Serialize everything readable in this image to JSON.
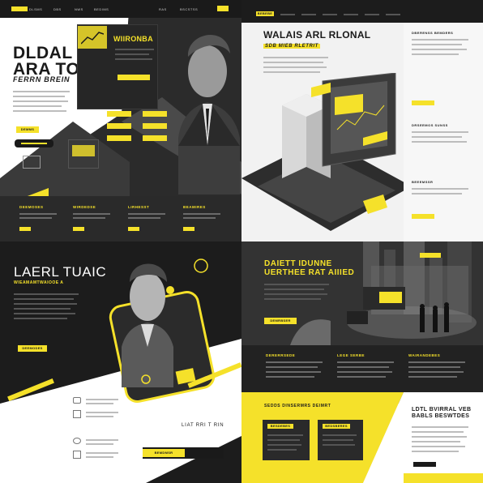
{
  "colors": {
    "accent": "#f5e12a",
    "dark": "#1a1a1a",
    "light": "#ffffff"
  },
  "q1": {
    "nav": [
      "DLSMS",
      "DBS",
      "NWS",
      "BEDIMS",
      "RAS",
      "BSCSTSS"
    ],
    "title_line1": "DLDAL",
    "title_line2": "ARA TOA",
    "subtitle": "FERRN BREIN",
    "panel_title": "WIIRONBA",
    "hero_button": "DEMMS",
    "columns": [
      "DEEMOSES",
      "WIRDEDSE",
      "LIRHESST",
      "BEAMIRES"
    ]
  },
  "q2": {
    "nav_button": "BEBEBE",
    "title": "WALAIS ARL RLONAL",
    "subtitle": "SDB MIEB RLETRIT",
    "side_heads": [
      "DBERENSS BEMDERS",
      "DRSEEMOS SUNSS",
      "BEEEMSSR"
    ]
  },
  "q3": {
    "title": "LAERL TUAIC",
    "subtitle": "WIEAMAMTWAIOOE A",
    "button": "DEEMODES",
    "footer_text": "LIAT RRI T RIN",
    "footer_button": "BEMDMSR"
  },
  "q4": {
    "title_line1": "DAIETT IDUNNE",
    "title_line2": "UERTHEE RAT AIIIED",
    "hero_button": "DEMRBSER",
    "columns": [
      "DERERRSEDE",
      "LEGE SERBE",
      "WAIRANDEBES"
    ],
    "band_title": "SEDDS DINSERMRS DEIMRT",
    "side_title_line1": "LDTL BVIRRAL VEB",
    "side_title_line2": "BABLS BESWTDES",
    "cards": [
      "BESDEBES",
      "BEDSBERES"
    ]
  }
}
